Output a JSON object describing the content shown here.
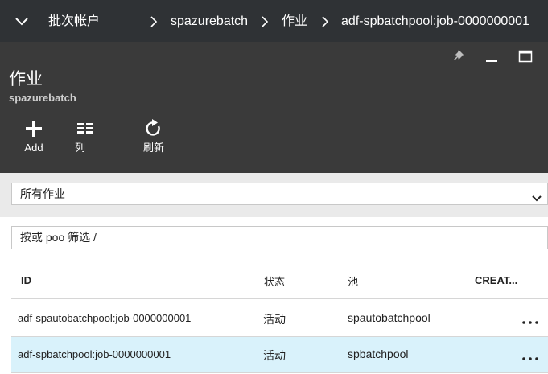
{
  "breadcrumb": {
    "items": [
      "批次帐户",
      "spazurebatch",
      "作业",
      "adf-spbatchpool:job-0000000001"
    ]
  },
  "blade": {
    "title": "作业",
    "subtitle": "spazurebatch",
    "commands": [
      {
        "label": "Add",
        "icon": "plus-icon"
      },
      {
        "label": "列",
        "icon": "columns-icon"
      },
      {
        "label": "刷新",
        "icon": "refresh-icon"
      }
    ],
    "window_controls": [
      "pin-icon",
      "minimize-icon",
      "maximize-icon"
    ]
  },
  "filters": {
    "dropdown_value": "所有作业",
    "search_value": "按或 poo 筛选 /"
  },
  "table": {
    "columns": [
      "ID",
      "状态",
      "池",
      "CREAT..."
    ],
    "rows": [
      {
        "id": "adf-spautobatchpool:job-0000000001",
        "state": "活动",
        "pool": "spautobatchpool",
        "selected": false
      },
      {
        "id": "adf-spbatchpool:job-0000000001",
        "state": "活动",
        "pool": "spbatchpool",
        "selected": true
      }
    ]
  },
  "colors": {
    "topbar_bg": "#2f3235",
    "blade_bg": "#3a3a3a",
    "selected_row_bg": "#d9f2fb"
  }
}
